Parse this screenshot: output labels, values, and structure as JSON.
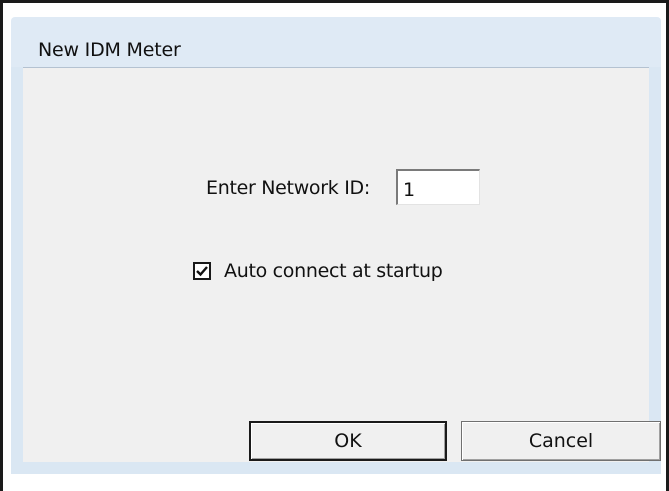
{
  "dialog": {
    "title": "New IDM Meter",
    "network_id_label": "Enter Network ID:",
    "network_id_value": "1",
    "auto_connect_label": "Auto connect at startup",
    "auto_connect_checked": true,
    "ok_label": "OK",
    "cancel_label": "Cancel"
  },
  "colors": {
    "title_bar": "#dfeaf5",
    "client_background": "#f0f0f0",
    "frame_border": "#1a1a1a"
  }
}
